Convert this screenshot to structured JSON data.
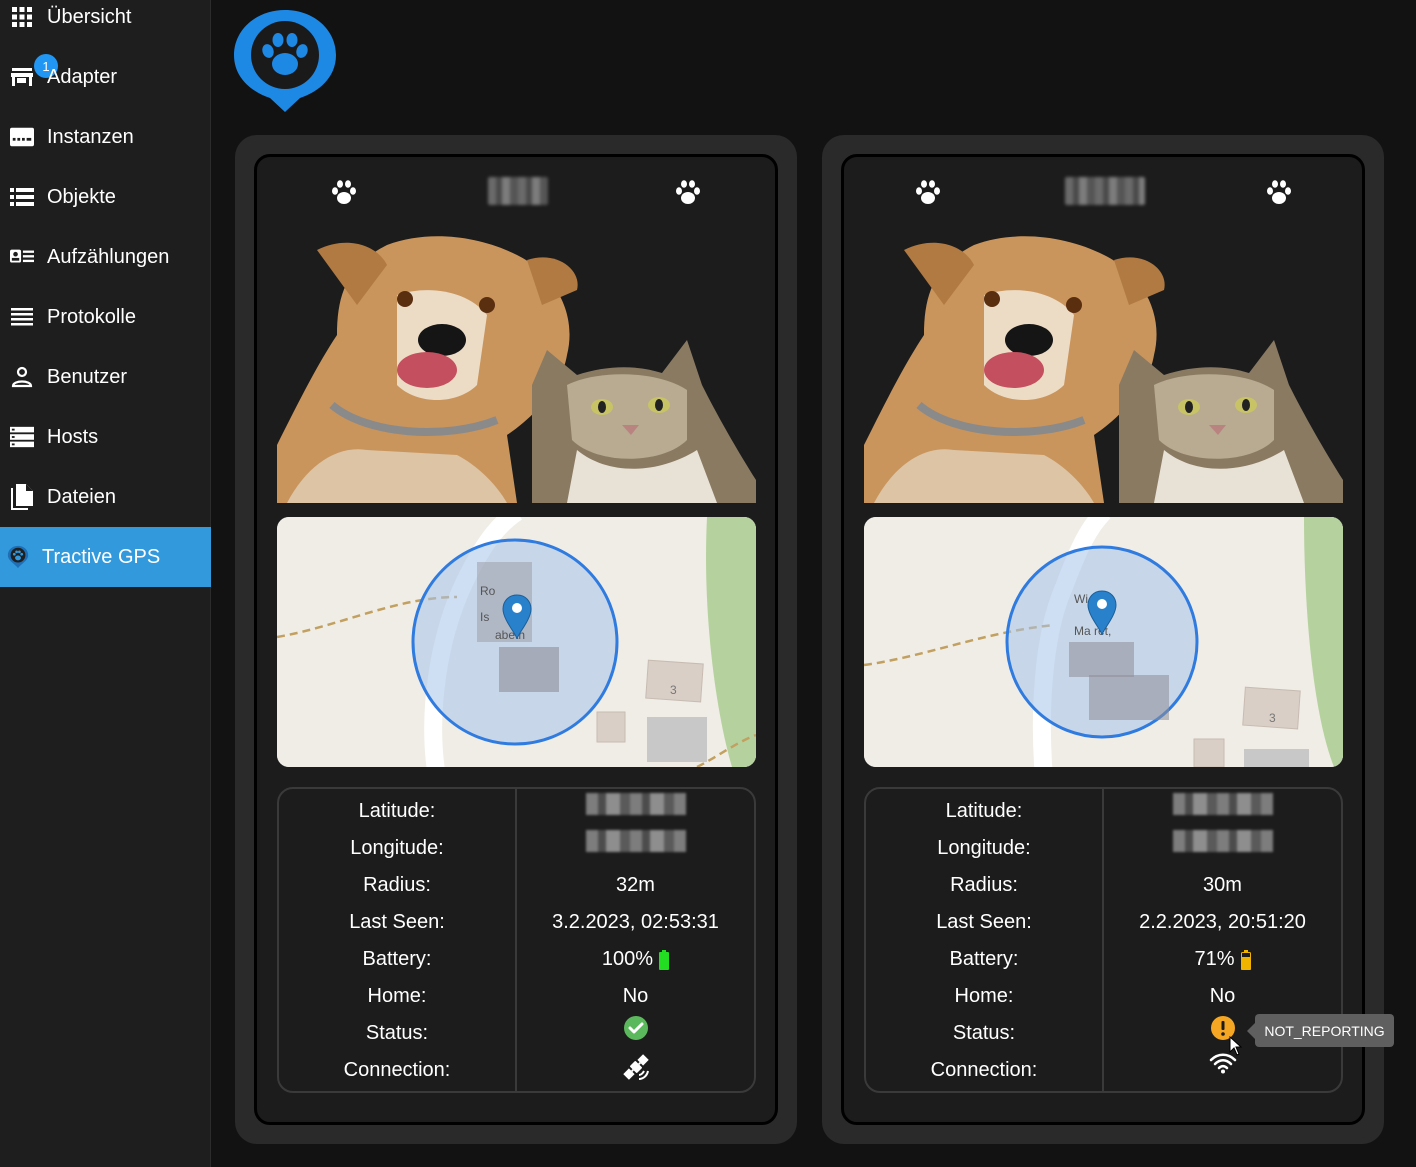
{
  "sidebar": {
    "items": [
      {
        "label": "Übersicht",
        "icon": "grid-icon"
      },
      {
        "label": "Adapter",
        "icon": "store-icon",
        "badge": "1"
      },
      {
        "label": "Instanzen",
        "icon": "instances-icon"
      },
      {
        "label": "Objekte",
        "icon": "list-icon"
      },
      {
        "label": "Aufzählungen",
        "icon": "enum-icon"
      },
      {
        "label": "Protokolle",
        "icon": "log-icon"
      },
      {
        "label": "Benutzer",
        "icon": "user-icon"
      },
      {
        "label": "Hosts",
        "icon": "hosts-icon"
      },
      {
        "label": "Dateien",
        "icon": "files-icon"
      },
      {
        "label": "Tractive GPS",
        "icon": "tractive-icon",
        "active": true
      }
    ]
  },
  "colors": {
    "accent": "#3399dd",
    "badge": "#2196f3",
    "logo": "#1e88e5",
    "battery_full": "#22dd22",
    "battery_mid": "#f0b400",
    "status_ok": "#5cb85c",
    "status_warn": "#f5a623"
  },
  "trackers": [
    {
      "name_hidden": true,
      "labels": {
        "latitude": "Latitude:",
        "longitude": "Longitude:",
        "radius": "Radius:",
        "last_seen": "Last Seen:",
        "battery": "Battery:",
        "home": "Home:",
        "status": "Status:",
        "connection": "Connection:"
      },
      "values": {
        "radius": "32m",
        "last_seen": "3.2.2023, 02:53:31",
        "battery": "100%",
        "battery_level": 1.0,
        "home": "No",
        "status_icon": "check-circle-icon",
        "connection_icon": "satellite-icon"
      },
      "map": {
        "label_1": "Ro",
        "label_2": "Is",
        "label_3": "abeth",
        "house_number": "3"
      }
    },
    {
      "name_hidden": true,
      "labels": {
        "latitude": "Latitude:",
        "longitude": "Longitude:",
        "radius": "Radius:",
        "last_seen": "Last Seen:",
        "battery": "Battery:",
        "home": "Home:",
        "status": "Status:",
        "connection": "Connection:"
      },
      "values": {
        "radius": "30m",
        "last_seen": "2.2.2023, 20:51:20",
        "battery": "71%",
        "battery_level": 0.71,
        "home": "No",
        "status_icon": "warning-circle-icon",
        "connection_icon": "wifi-icon"
      },
      "map": {
        "label_1": "Wi   er",
        "label_2": "Ma   ret,",
        "house_number": "3"
      }
    }
  ],
  "tooltip": {
    "text": "NOT_REPORTING"
  }
}
